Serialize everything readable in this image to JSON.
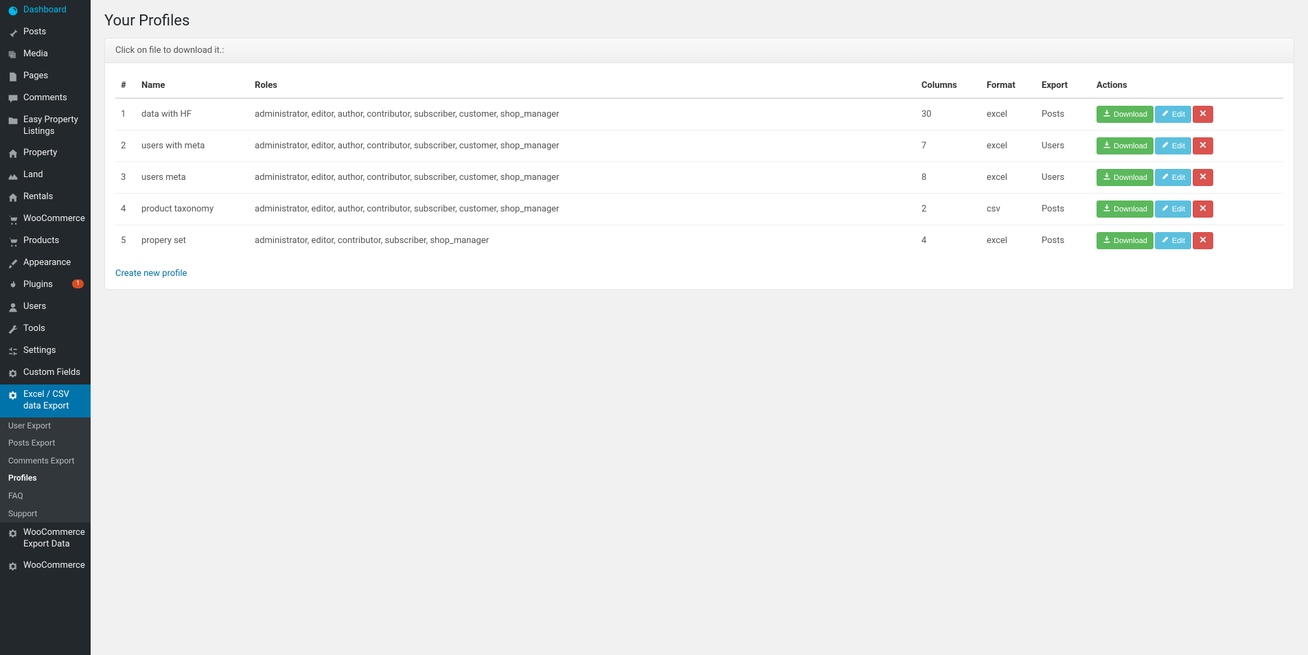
{
  "page": {
    "title": "Your Profiles",
    "hint": "Click on file to download it.:",
    "create_link": "Create new profile"
  },
  "sidebar": {
    "items": [
      {
        "label": "Dashboard",
        "icon": "dashboard"
      },
      {
        "label": "Posts",
        "icon": "pin"
      },
      {
        "label": "Media",
        "icon": "media"
      },
      {
        "label": "Pages",
        "icon": "pages"
      },
      {
        "label": "Comments",
        "icon": "comment"
      },
      {
        "label": "Easy Property Listings",
        "icon": "folder"
      },
      {
        "label": "Property",
        "icon": "home"
      },
      {
        "label": "Land",
        "icon": "land"
      },
      {
        "label": "Rentals",
        "icon": "home"
      },
      {
        "label": "WooCommerce",
        "icon": "cart"
      },
      {
        "label": "Products",
        "icon": "cart"
      },
      {
        "label": "Appearance",
        "icon": "brush"
      },
      {
        "label": "Plugins",
        "icon": "plug",
        "badge": "1"
      },
      {
        "label": "Users",
        "icon": "user"
      },
      {
        "label": "Tools",
        "icon": "wrench"
      },
      {
        "label": "Settings",
        "icon": "sliders"
      },
      {
        "label": "Custom Fields",
        "icon": "gear"
      },
      {
        "label": "Excel / CSV data Export",
        "icon": "gear",
        "active": true,
        "submenu": [
          {
            "label": "User Export"
          },
          {
            "label": "Posts Export"
          },
          {
            "label": "Comments Export"
          },
          {
            "label": "Profiles",
            "active": true
          },
          {
            "label": "FAQ"
          },
          {
            "label": "Support"
          }
        ]
      },
      {
        "label": "WooCommerce Export Data",
        "icon": "gear"
      },
      {
        "label": "WooCommerce",
        "icon": "gear"
      }
    ]
  },
  "table": {
    "headers": {
      "num": "#",
      "name": "Name",
      "roles": "Roles",
      "columns": "Columns",
      "format": "Format",
      "export": "Export",
      "actions": "Actions"
    },
    "action_labels": {
      "download": "Download",
      "edit": "Edit"
    },
    "rows": [
      {
        "num": "1",
        "name": "data with HF",
        "roles": "administrator, editor, author, contributor, subscriber, customer, shop_manager",
        "columns": "30",
        "format": "excel",
        "export": "Posts"
      },
      {
        "num": "2",
        "name": "users with meta",
        "roles": "administrator, editor, author, contributor, subscriber, customer, shop_manager",
        "columns": "7",
        "format": "excel",
        "export": "Users"
      },
      {
        "num": "3",
        "name": "users meta",
        "roles": "administrator, editor, author, contributor, subscriber, customer, shop_manager",
        "columns": "8",
        "format": "excel",
        "export": "Users"
      },
      {
        "num": "4",
        "name": "product taxonomy",
        "roles": "administrator, editor, author, contributor, subscriber, customer, shop_manager",
        "columns": "2",
        "format": "csv",
        "export": "Posts"
      },
      {
        "num": "5",
        "name": "propery set",
        "roles": "administrator, editor, contributor, subscriber, shop_manager",
        "columns": "4",
        "format": "excel",
        "export": "Posts"
      }
    ]
  }
}
